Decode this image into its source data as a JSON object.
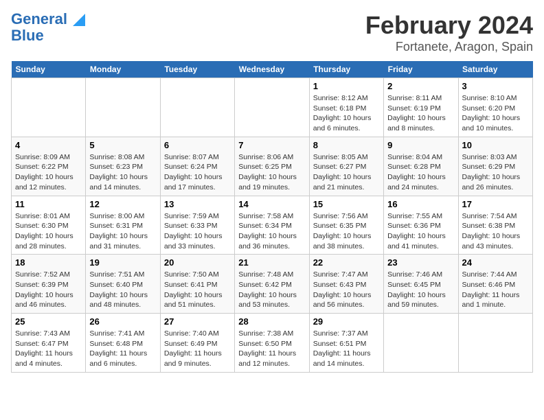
{
  "logo": {
    "line1": "General",
    "line2": "Blue"
  },
  "title": "February 2024",
  "subtitle": "Fortanete, Aragon, Spain",
  "days_of_week": [
    "Sunday",
    "Monday",
    "Tuesday",
    "Wednesday",
    "Thursday",
    "Friday",
    "Saturday"
  ],
  "weeks": [
    [
      {
        "day": "",
        "info": ""
      },
      {
        "day": "",
        "info": ""
      },
      {
        "day": "",
        "info": ""
      },
      {
        "day": "",
        "info": ""
      },
      {
        "day": "1",
        "info": "Sunrise: 8:12 AM\nSunset: 6:18 PM\nDaylight: 10 hours\nand 6 minutes."
      },
      {
        "day": "2",
        "info": "Sunrise: 8:11 AM\nSunset: 6:19 PM\nDaylight: 10 hours\nand 8 minutes."
      },
      {
        "day": "3",
        "info": "Sunrise: 8:10 AM\nSunset: 6:20 PM\nDaylight: 10 hours\nand 10 minutes."
      }
    ],
    [
      {
        "day": "4",
        "info": "Sunrise: 8:09 AM\nSunset: 6:22 PM\nDaylight: 10 hours\nand 12 minutes."
      },
      {
        "day": "5",
        "info": "Sunrise: 8:08 AM\nSunset: 6:23 PM\nDaylight: 10 hours\nand 14 minutes."
      },
      {
        "day": "6",
        "info": "Sunrise: 8:07 AM\nSunset: 6:24 PM\nDaylight: 10 hours\nand 17 minutes."
      },
      {
        "day": "7",
        "info": "Sunrise: 8:06 AM\nSunset: 6:25 PM\nDaylight: 10 hours\nand 19 minutes."
      },
      {
        "day": "8",
        "info": "Sunrise: 8:05 AM\nSunset: 6:27 PM\nDaylight: 10 hours\nand 21 minutes."
      },
      {
        "day": "9",
        "info": "Sunrise: 8:04 AM\nSunset: 6:28 PM\nDaylight: 10 hours\nand 24 minutes."
      },
      {
        "day": "10",
        "info": "Sunrise: 8:03 AM\nSunset: 6:29 PM\nDaylight: 10 hours\nand 26 minutes."
      }
    ],
    [
      {
        "day": "11",
        "info": "Sunrise: 8:01 AM\nSunset: 6:30 PM\nDaylight: 10 hours\nand 28 minutes."
      },
      {
        "day": "12",
        "info": "Sunrise: 8:00 AM\nSunset: 6:31 PM\nDaylight: 10 hours\nand 31 minutes."
      },
      {
        "day": "13",
        "info": "Sunrise: 7:59 AM\nSunset: 6:33 PM\nDaylight: 10 hours\nand 33 minutes."
      },
      {
        "day": "14",
        "info": "Sunrise: 7:58 AM\nSunset: 6:34 PM\nDaylight: 10 hours\nand 36 minutes."
      },
      {
        "day": "15",
        "info": "Sunrise: 7:56 AM\nSunset: 6:35 PM\nDaylight: 10 hours\nand 38 minutes."
      },
      {
        "day": "16",
        "info": "Sunrise: 7:55 AM\nSunset: 6:36 PM\nDaylight: 10 hours\nand 41 minutes."
      },
      {
        "day": "17",
        "info": "Sunrise: 7:54 AM\nSunset: 6:38 PM\nDaylight: 10 hours\nand 43 minutes."
      }
    ],
    [
      {
        "day": "18",
        "info": "Sunrise: 7:52 AM\nSunset: 6:39 PM\nDaylight: 10 hours\nand 46 minutes."
      },
      {
        "day": "19",
        "info": "Sunrise: 7:51 AM\nSunset: 6:40 PM\nDaylight: 10 hours\nand 48 minutes."
      },
      {
        "day": "20",
        "info": "Sunrise: 7:50 AM\nSunset: 6:41 PM\nDaylight: 10 hours\nand 51 minutes."
      },
      {
        "day": "21",
        "info": "Sunrise: 7:48 AM\nSunset: 6:42 PM\nDaylight: 10 hours\nand 53 minutes."
      },
      {
        "day": "22",
        "info": "Sunrise: 7:47 AM\nSunset: 6:43 PM\nDaylight: 10 hours\nand 56 minutes."
      },
      {
        "day": "23",
        "info": "Sunrise: 7:46 AM\nSunset: 6:45 PM\nDaylight: 10 hours\nand 59 minutes."
      },
      {
        "day": "24",
        "info": "Sunrise: 7:44 AM\nSunset: 6:46 PM\nDaylight: 11 hours\nand 1 minute."
      }
    ],
    [
      {
        "day": "25",
        "info": "Sunrise: 7:43 AM\nSunset: 6:47 PM\nDaylight: 11 hours\nand 4 minutes."
      },
      {
        "day": "26",
        "info": "Sunrise: 7:41 AM\nSunset: 6:48 PM\nDaylight: 11 hours\nand 6 minutes."
      },
      {
        "day": "27",
        "info": "Sunrise: 7:40 AM\nSunset: 6:49 PM\nDaylight: 11 hours\nand 9 minutes."
      },
      {
        "day": "28",
        "info": "Sunrise: 7:38 AM\nSunset: 6:50 PM\nDaylight: 11 hours\nand 12 minutes."
      },
      {
        "day": "29",
        "info": "Sunrise: 7:37 AM\nSunset: 6:51 PM\nDaylight: 11 hours\nand 14 minutes."
      },
      {
        "day": "",
        "info": ""
      },
      {
        "day": "",
        "info": ""
      }
    ]
  ],
  "colors": {
    "header_bg": "#2a6db5",
    "header_text": "#ffffff",
    "accent": "#2a9df4"
  }
}
